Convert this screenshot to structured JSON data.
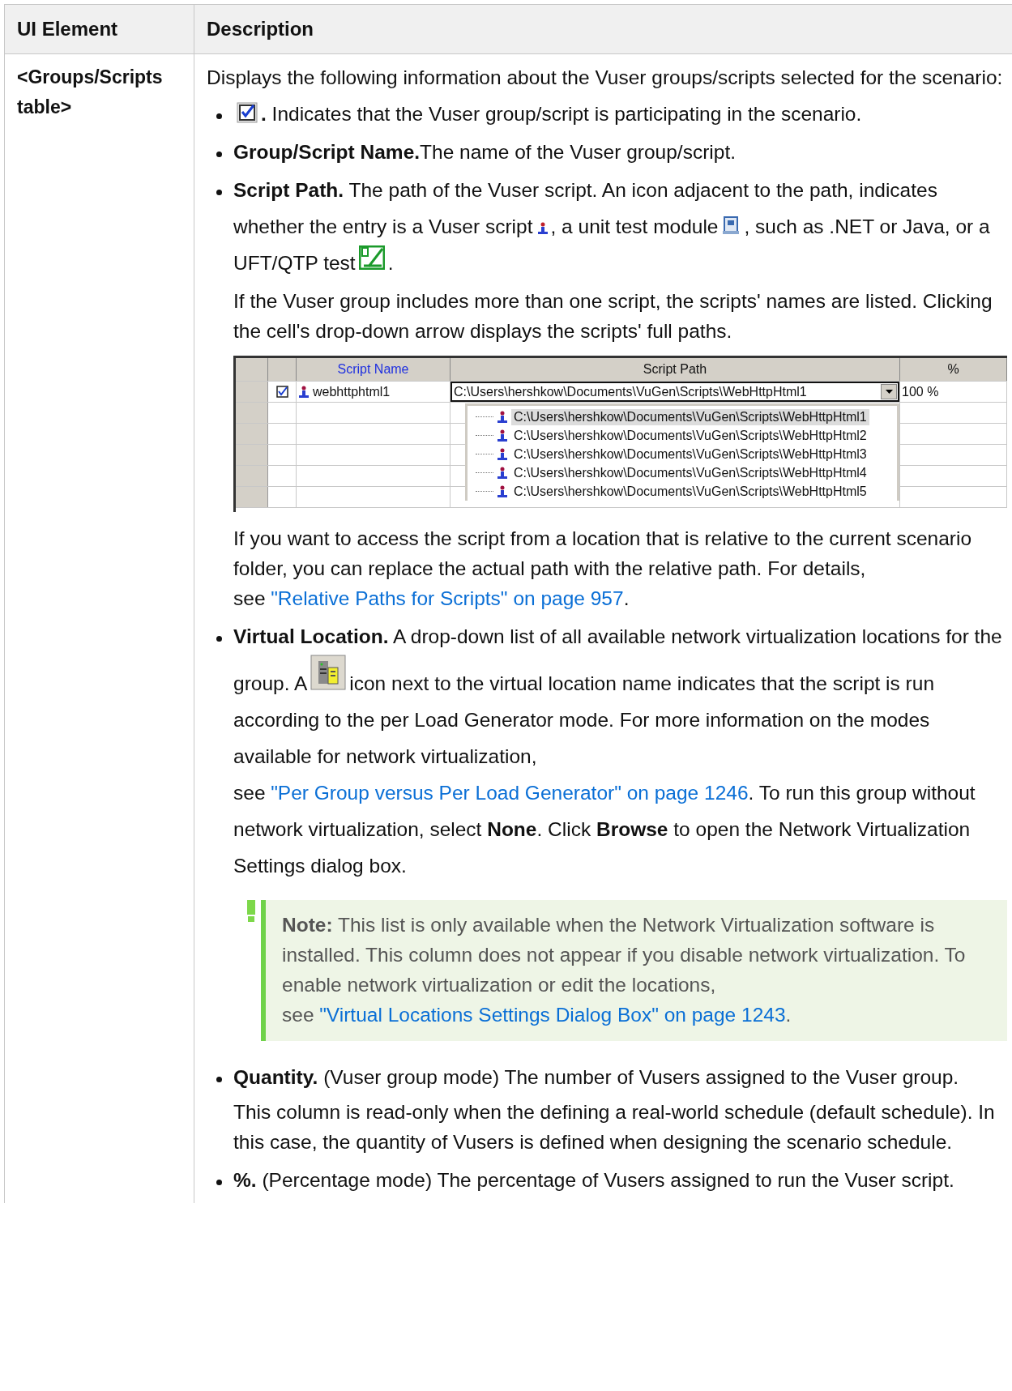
{
  "table": {
    "columns": [
      "UI Element",
      "Description"
    ],
    "rows": [
      {
        "element": "<Groups/Scripts table>",
        "intro": [
          {
            "kind": "text",
            "text": "Displays the following information about the Vuser groups/scripts selected for the scenario:"
          }
        ],
        "bullets": [
          {
            "blocks": [
              {
                "kind": "para",
                "segments": [
                  {
                    "kind": "checkbox"
                  },
                  {
                    "kind": "text",
                    "text": "**.** Indicates that the Vuser group/script is participating in the scenario."
                  }
                ]
              }
            ]
          },
          {
            "blocks": [
              {
                "kind": "para",
                "segments": [
                  {
                    "kind": "text",
                    "text": "**Group/Script Name.**The name of the Vuser group/script."
                  }
                ]
              }
            ]
          },
          {
            "blocks": [
              {
                "kind": "para",
                "segments": [
                  {
                    "kind": "text",
                    "text": "**Script Path.** The path of the Vuser script. An icon adjacent to the path, indicates whether the entry is a Vuser script"
                  },
                  {
                    "kind": "script"
                  },
                  {
                    "kind": "text",
                    "text": ", a unit test module"
                  },
                  {
                    "kind": "module"
                  },
                  {
                    "kind": "text",
                    "text": ", such as .NET or Java, or a UFT/QTP test"
                  },
                  {
                    "kind": "test"
                  },
                  {
                    "kind": "text",
                    "text": "."
                  }
                ]
              },
              {
                "kind": "para",
                "segments": [
                  {
                    "kind": "text",
                    "text": "If the Vuser group includes more than one script, the scripts' names are listed. Clicking the cell's drop-down arrow displays the scripts' full paths."
                  }
                ]
              },
              {
                "kind": "screenshot",
                "shot": {
                  "columns": [
                    "Script Name",
                    "Script Path",
                    "%"
                  ],
                  "rows": [
                    {
                      "checked": true,
                      "name": "webhttphtml1",
                      "path": "C:\\Users\\hershkow\\Documents\\VuGen\\Scripts\\WebHttpHtml1",
                      "percent": "100 %"
                    }
                  ],
                  "dropdown": [
                    {
                      "path": "C:\\Users\\hershkow\\Documents\\VuGen\\Scripts\\WebHttpHtml1",
                      "selected": true
                    },
                    {
                      "path": "C:\\Users\\hershkow\\Documents\\VuGen\\Scripts\\WebHttpHtml2",
                      "selected": false
                    },
                    {
                      "path": "C:\\Users\\hershkow\\Documents\\VuGen\\Scripts\\WebHttpHtml3",
                      "selected": false
                    },
                    {
                      "path": "C:\\Users\\hershkow\\Documents\\VuGen\\Scripts\\WebHttpHtml4",
                      "selected": false
                    },
                    {
                      "path": "C:\\Users\\hershkow\\Documents\\VuGen\\Scripts\\WebHttpHtml5",
                      "selected": false
                    }
                  ]
                }
              },
              {
                "kind": "para",
                "segments": [
                  {
                    "kind": "text",
                    "text": "If you want to access the script from a location that is relative to the current scenario folder, you can replace the actual path with the relative path. For details, see"
                  },
                  {
                    "kind": "link",
                    "text": "\"Relative Paths for Scripts\" on page 957"
                  },
                  {
                    "kind": "text",
                    "text": "."
                  }
                ]
              }
            ]
          },
          {
            "blocks": [
              {
                "kind": "para",
                "segments": [
                  {
                    "kind": "text",
                    "text": "**Virtual Location.** A drop-down list of all available network virtualization locations for the group. A"
                  },
                  {
                    "kind": "location"
                  },
                  {
                    "kind": "text",
                    "text": "icon next to the virtual location name indicates that the script is run according to the per Load Generator mode. For more information on the modes available for network virtualization, see"
                  },
                  {
                    "kind": "link",
                    "text": "\"Per Group versus Per Load Generator\" on page 1246"
                  },
                  {
                    "kind": "text",
                    "text": ". To run this group without network virtualization, select **None**. Click **Browse** to open the Network Virtualization Settings dialog box."
                  }
                ]
              },
              {
                "kind": "note",
                "segments": [
                  {
                    "kind": "text",
                    "text": "**Note:** This list is only available when the Network Virtualization software is installed. This column does not appear if you disable network virtualization. To enable network virtualization or edit the locations, see"
                  },
                  {
                    "kind": "link",
                    "text": "\"Virtual Locations Settings Dialog Box\" on page 1243"
                  },
                  {
                    "kind": "text",
                    "text": "."
                  }
                ]
              }
            ]
          },
          {
            "blocks": [
              {
                "kind": "para",
                "segments": [
                  {
                    "kind": "text",
                    "text": "**Quantity.** (Vuser group mode) The number of Vusers assigned to the Vuser group."
                  }
                ]
              },
              {
                "kind": "para",
                "segments": [
                  {
                    "kind": "text",
                    "text": "This column is read-only when the defining a real-world schedule (default schedule). In this case, the quantity of Vusers is defined when designing the scenario schedule."
                  }
                ]
              }
            ]
          },
          {
            "blocks": [
              {
                "kind": "para",
                "segments": [
                  {
                    "kind": "text",
                    "text": "**%.** (Percentage mode) The percentage of Vusers assigned to run the Vuser script."
                  }
                ]
              }
            ]
          }
        ]
      }
    ]
  }
}
